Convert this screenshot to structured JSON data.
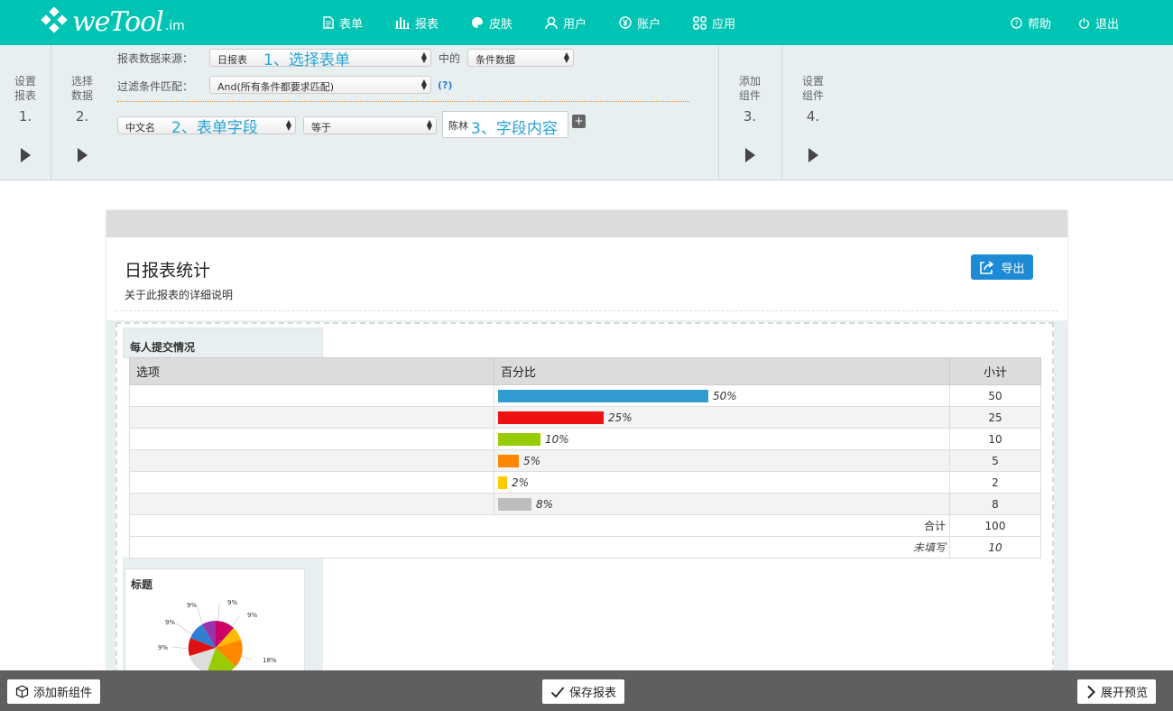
{
  "brand": {
    "logo_text": "weTool",
    "logo_sub": ".im"
  },
  "nav": {
    "items": [
      {
        "label": "表单",
        "icon": "document-icon"
      },
      {
        "label": "报表",
        "icon": "bar-chart-icon"
      },
      {
        "label": "皮肤",
        "icon": "palette-icon"
      },
      {
        "label": "用户",
        "icon": "user-icon"
      },
      {
        "label": "账户",
        "icon": "yen-icon"
      },
      {
        "label": "应用",
        "icon": "apps-icon"
      }
    ],
    "help": "帮助",
    "logout": "退出"
  },
  "steps": {
    "step1": {
      "line1": "设置",
      "line2": "报表",
      "num": "1."
    },
    "step2": {
      "line1": "选择",
      "line2": "数据",
      "num": "2."
    },
    "step3": {
      "line1": "添加",
      "line2": "组件",
      "num": "3."
    },
    "step4": {
      "line1": "设置",
      "line2": "组件",
      "num": "4."
    }
  },
  "form": {
    "source_label": "报表数据来源：",
    "source_value": "日报表",
    "source_hint": "1、选择表单",
    "middle_label": "中的",
    "data_type_value": "条件数据",
    "filter_label": "过滤条件匹配：",
    "filter_value": "And(所有条件都要求匹配)",
    "filter_help": "(?)",
    "field_value": "中文名",
    "field_hint": "2、表单字段",
    "operator_value": "等于",
    "text_value": "陈林",
    "text_hint": "3、字段内容",
    "plus": "+"
  },
  "report": {
    "title": "日报表统计",
    "description": "关于此报表的详细说明",
    "export_label": "导出",
    "widget_title": "每人提交情况",
    "table": {
      "headers": {
        "option": "选项",
        "percent": "百分比",
        "subtotal": "小计"
      },
      "rows": [
        {
          "option": "",
          "percent": "50%",
          "value": "50",
          "ratio": 0.5,
          "color": "#2f9bd1"
        },
        {
          "option": "",
          "percent": "25%",
          "value": "25",
          "ratio": 0.25,
          "color": "#ee1111"
        },
        {
          "option": "",
          "percent": "10%",
          "value": "10",
          "ratio": 0.1,
          "color": "#99cc00"
        },
        {
          "option": "",
          "percent": "5%",
          "value": "5",
          "ratio": 0.05,
          "color": "#ff8800"
        },
        {
          "option": "",
          "percent": "2%",
          "value": "2",
          "ratio": 0.02,
          "color": "#ffcc00"
        },
        {
          "option": "",
          "percent": "8%",
          "value": "8",
          "ratio": 0.08,
          "color": "#bdbdbd"
        }
      ],
      "total_label": "合计",
      "total_value": "100",
      "unfilled_label": "未填写",
      "unfilled_value": "10"
    },
    "pie_widget": {
      "title": "标题",
      "labels": [
        "9%",
        "9%",
        "9%",
        "9%",
        "9%",
        "18%"
      ]
    }
  },
  "bottom": {
    "add_widget": "添加新组件",
    "save": "保存报表",
    "preview": "展开预览"
  },
  "colors": {
    "header": "#00c4b3",
    "accent": "#1d8ad4",
    "hint": "#27a3d4"
  }
}
